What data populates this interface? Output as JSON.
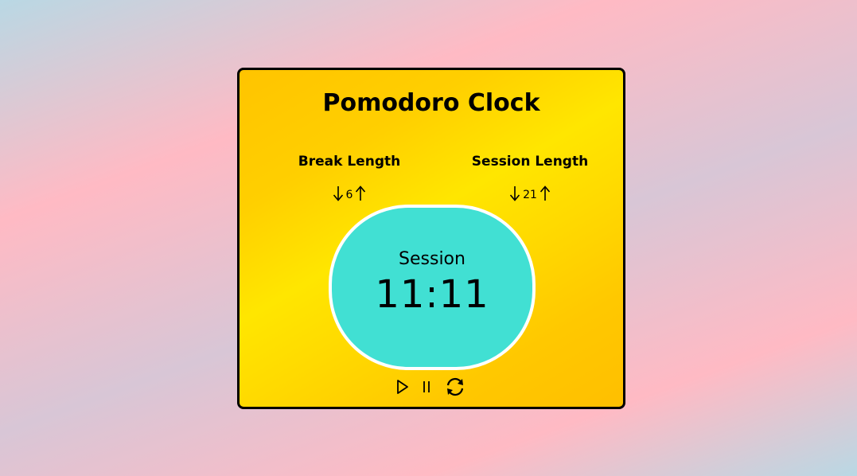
{
  "app": {
    "title": "Pomodoro Clock"
  },
  "break": {
    "label": "Break Length",
    "value": "6",
    "decrement_icon": "arrow-down-icon",
    "increment_icon": "arrow-up-icon"
  },
  "session": {
    "label": "Session Length",
    "value": "21",
    "decrement_icon": "arrow-down-icon",
    "increment_icon": "arrow-up-icon"
  },
  "timer": {
    "label": "Session",
    "time": "11:11"
  },
  "controls": {
    "play_icon": "play-icon",
    "pause_icon": "pause-icon",
    "reset_icon": "refresh-icon"
  },
  "colors": {
    "timer_bg": "#41e0d3",
    "card_gradient_start": "#ffc400",
    "card_gradient_mid": "#ffe600",
    "border": "#000000"
  }
}
